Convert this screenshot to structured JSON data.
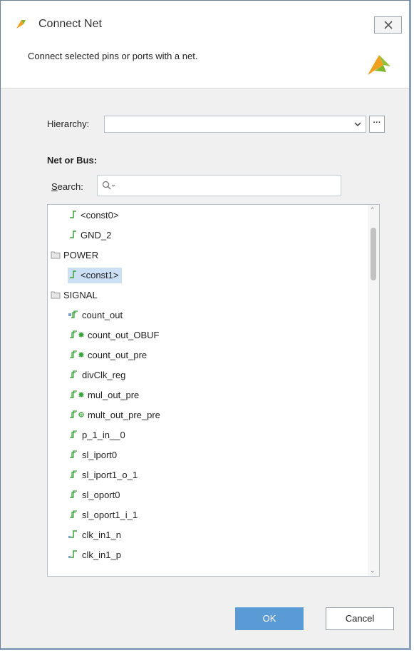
{
  "window": {
    "title": "Connect Net",
    "close_label": "✕"
  },
  "banner": {
    "text": "Connect selected pins or ports with a net."
  },
  "hierarchy": {
    "label": "Hierarchy:",
    "value": "",
    "more_label": "···"
  },
  "net": {
    "title": "Net or Bus:",
    "search_label_prefix": "S",
    "search_label_rest": "earch:",
    "search_value": ""
  },
  "tree": [
    {
      "label": "<const0>",
      "kind": "net-const",
      "depth": 1,
      "selected": false
    },
    {
      "label": "GND_2",
      "kind": "net-const",
      "depth": 1,
      "selected": false
    },
    {
      "label": "POWER",
      "kind": "folder",
      "depth": 0,
      "selected": false
    },
    {
      "label": "<const1>",
      "kind": "net-const",
      "depth": 1,
      "selected": true
    },
    {
      "label": "SIGNAL",
      "kind": "folder",
      "depth": 0,
      "selected": false
    },
    {
      "label": "count_out",
      "kind": "bus-port",
      "depth": 1,
      "selected": false
    },
    {
      "label": "count_out_OBUF",
      "kind": "bus-mark",
      "depth": 1,
      "selected": false
    },
    {
      "label": "count_out_pre",
      "kind": "bus-mark",
      "depth": 1,
      "selected": false
    },
    {
      "label": "divClk_reg",
      "kind": "bus",
      "depth": 1,
      "selected": false
    },
    {
      "label": "mul_out_pre",
      "kind": "bus-mark",
      "depth": 1,
      "selected": false
    },
    {
      "label": "mult_out_pre_pre",
      "kind": "bus-gear",
      "depth": 1,
      "selected": false
    },
    {
      "label": "p_1_in__0",
      "kind": "bus",
      "depth": 1,
      "selected": false
    },
    {
      "label": "sl_iport0",
      "kind": "bus",
      "depth": 1,
      "selected": false
    },
    {
      "label": "sl_iport1_o_1",
      "kind": "bus",
      "depth": 1,
      "selected": false
    },
    {
      "label": "sl_oport0",
      "kind": "bus",
      "depth": 1,
      "selected": false
    },
    {
      "label": "sl_oport1_i_1",
      "kind": "bus",
      "depth": 1,
      "selected": false
    },
    {
      "label": "clk_in1_n",
      "kind": "net",
      "depth": 1,
      "selected": false
    },
    {
      "label": "clk_in1_p",
      "kind": "net",
      "depth": 1,
      "selected": false
    }
  ],
  "buttons": {
    "ok": "OK",
    "cancel": "Cancel"
  },
  "colors": {
    "accent": "#5b9bd5",
    "net_icon": "#3aa33a",
    "selection": "#cce0f5",
    "logo_orange": "#f0a020",
    "logo_green": "#7fb62a"
  }
}
